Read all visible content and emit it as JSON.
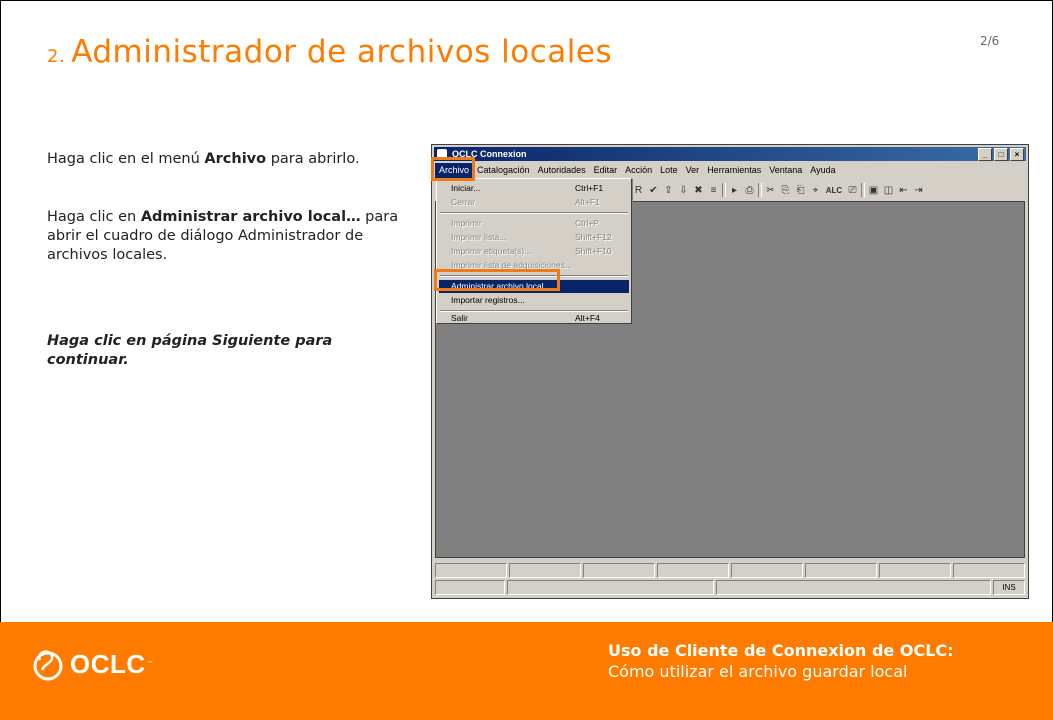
{
  "slide": {
    "title_number": "2.",
    "title": "Administrador de archivos locales",
    "pager": "2/6"
  },
  "instructions": {
    "step1_pre": "Haga clic en el menú ",
    "step1_bold": "Archivo",
    "step1_post": " para abrirlo.",
    "step2_pre": "Haga clic en ",
    "step2_bold": "Administrar archivo local…",
    "step2_post": " para abrir el cuadro de diálogo Administrador de archivos locales.",
    "step3": "Haga clic en página Siguiente para continuar."
  },
  "app": {
    "window_title": "OCLC Connexion",
    "window_buttons": [
      "_",
      "□",
      "×"
    ],
    "menu": [
      "Archivo",
      "Catalogación",
      "Autoridades",
      "Editar",
      "Acción",
      "Lote",
      "Ver",
      "Herramientas",
      "Ventana",
      "Ayuda"
    ],
    "file_menu": [
      {
        "label": "Iniciar...",
        "shortcut": "Ctrl+F1",
        "enabled": true
      },
      {
        "label": "Cerrar",
        "shortcut": "Alt+F1",
        "enabled": false
      },
      {
        "label": "Imprimir",
        "shortcut": "Ctrl+P",
        "enabled": false
      },
      {
        "label": "Imprimir lista...",
        "shortcut": "Shift+F12",
        "enabled": false
      },
      {
        "label": "Imprimir etiqueta(s)...",
        "shortcut": "Shift+F10",
        "enabled": false
      },
      {
        "label": "Imprimir lista de adquisiciones...",
        "shortcut": "",
        "enabled": false
      },
      {
        "label": "Administrar archivo local...",
        "shortcut": "",
        "enabled": true
      },
      {
        "label": "Importar registros...",
        "shortcut": "",
        "enabled": true
      },
      {
        "label": "Salir",
        "shortcut": "Alt+F4",
        "enabled": true
      }
    ],
    "toolbar_icons": [
      "R",
      "✔",
      "⇪",
      "⇩",
      "✖",
      "≡",
      "▸",
      "⎙",
      "✂",
      "⎘",
      "⎗",
      "⌖",
      "ALC",
      "⎚",
      "▣",
      "◫",
      "⇤",
      "⇥"
    ],
    "status_indicator": "INS"
  },
  "footer": {
    "logo_text": "OCLC",
    "logo_tm": "™",
    "title": "Uso de Cliente de Connexion de OCLC:",
    "subtitle": "Cómo utilizar el archivo guardar local"
  },
  "colors": {
    "accent": "#ff7b00",
    "highlight_box": "#f27a16",
    "menu_selection": "#0a246a"
  }
}
